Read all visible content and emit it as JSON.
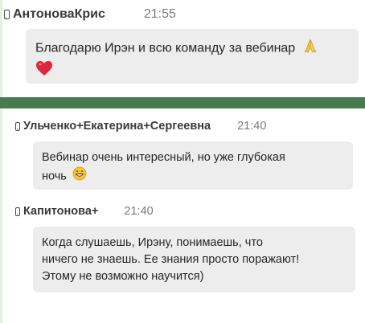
{
  "colors": {
    "divider": "#4a7a4f",
    "side_accent": "#e3f1df",
    "bubble_bg": "#ededed",
    "author_text": "#3a3a3a",
    "time_text": "#7b7b7b"
  },
  "messages": [
    {
      "author": "АнтоноваКрис",
      "time": "21:55",
      "text": "Благодарю Ирэн и всю команду за вебинар",
      "emojis": [
        "praying-hands",
        "red-heart"
      ]
    },
    {
      "author": "Ульченко+Екатерина+Сергеевна",
      "time": "21:40",
      "lines": [
        "Вебинар очень интересный, но уже глубокая",
        "ночь"
      ],
      "emojis": [
        "grinning-sweat-face"
      ]
    },
    {
      "author": "Капитонова+",
      "time": "21:40",
      "lines": [
        "Когда слушаешь, Ирэну, понимаешь, что",
        "ничего не знаешь. Ее знания просто поражают!",
        "Этому не возможно научится)"
      ]
    }
  ]
}
